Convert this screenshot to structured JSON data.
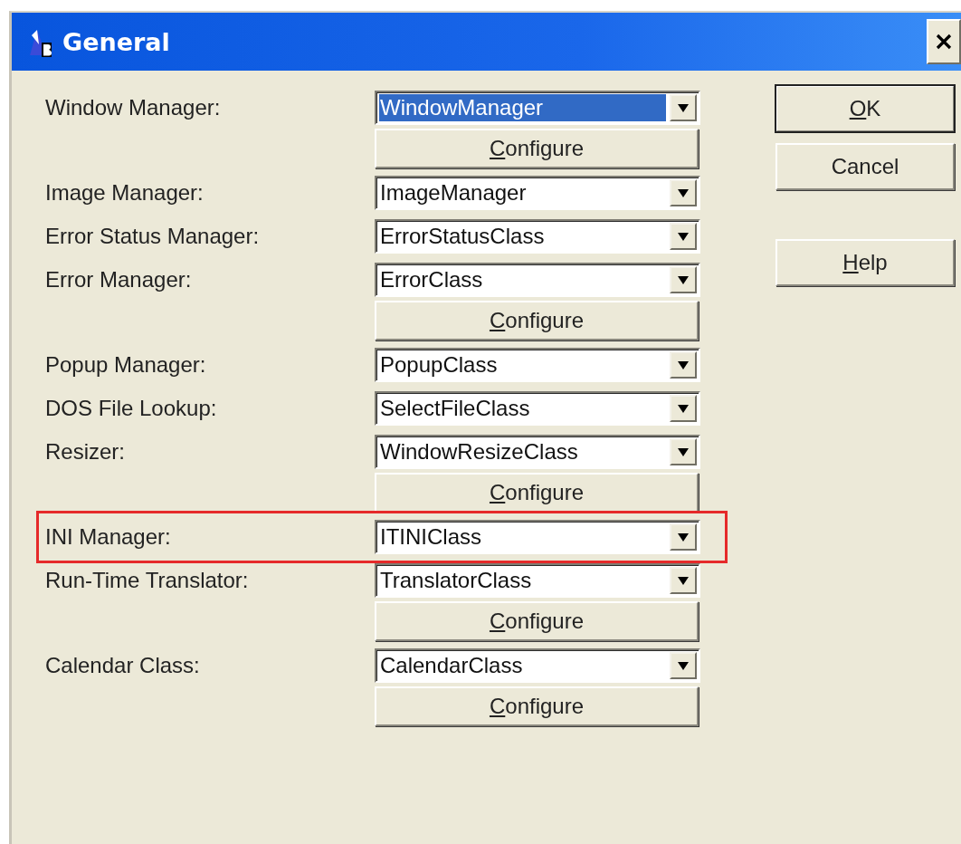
{
  "window": {
    "title": "General"
  },
  "rows": [
    {
      "kind": "combo",
      "label": "Window Manager:",
      "value": "WindowManager",
      "selected": true,
      "highlighted": false
    },
    {
      "kind": "configure",
      "label": "Configure",
      "underline_first": true
    },
    {
      "kind": "combo",
      "label": "Image Manager:",
      "value": "ImageManager",
      "selected": false,
      "highlighted": false
    },
    {
      "kind": "combo",
      "label": "Error Status Manager:",
      "value": "ErrorStatusClass",
      "selected": false,
      "highlighted": false
    },
    {
      "kind": "combo",
      "label": "Error Manager:",
      "value": "ErrorClass",
      "selected": false,
      "highlighted": false
    },
    {
      "kind": "configure",
      "label": "Configure",
      "underline_first": true
    },
    {
      "kind": "combo",
      "label": "Popup Manager:",
      "value": "PopupClass",
      "selected": false,
      "highlighted": false
    },
    {
      "kind": "combo",
      "label": "DOS File Lookup:",
      "value": "SelectFileClass",
      "selected": false,
      "highlighted": false
    },
    {
      "kind": "combo",
      "label": "Resizer:",
      "value": "WindowResizeClass",
      "selected": false,
      "highlighted": false
    },
    {
      "kind": "configure",
      "label": "Configure",
      "underline_first": true
    },
    {
      "kind": "combo",
      "label": "INI Manager:",
      "value": "ITINIClass",
      "selected": false,
      "highlighted": true
    },
    {
      "kind": "combo",
      "label": "Run-Time Translator:",
      "value": "TranslatorClass",
      "selected": false,
      "highlighted": false
    },
    {
      "kind": "configure",
      "label": "Configure",
      "underline_first": true
    },
    {
      "kind": "combo",
      "label": "Calendar Class:",
      "value": "CalendarClass",
      "selected": false,
      "highlighted": false
    },
    {
      "kind": "configure",
      "label": "Configure",
      "underline_first": true
    }
  ],
  "buttons": [
    {
      "label": "OK",
      "underline_first": true,
      "default": true
    },
    {
      "label": "Cancel",
      "underline_first": false,
      "default": false
    },
    {
      "label": "Help",
      "underline_first": true,
      "default": false
    }
  ]
}
